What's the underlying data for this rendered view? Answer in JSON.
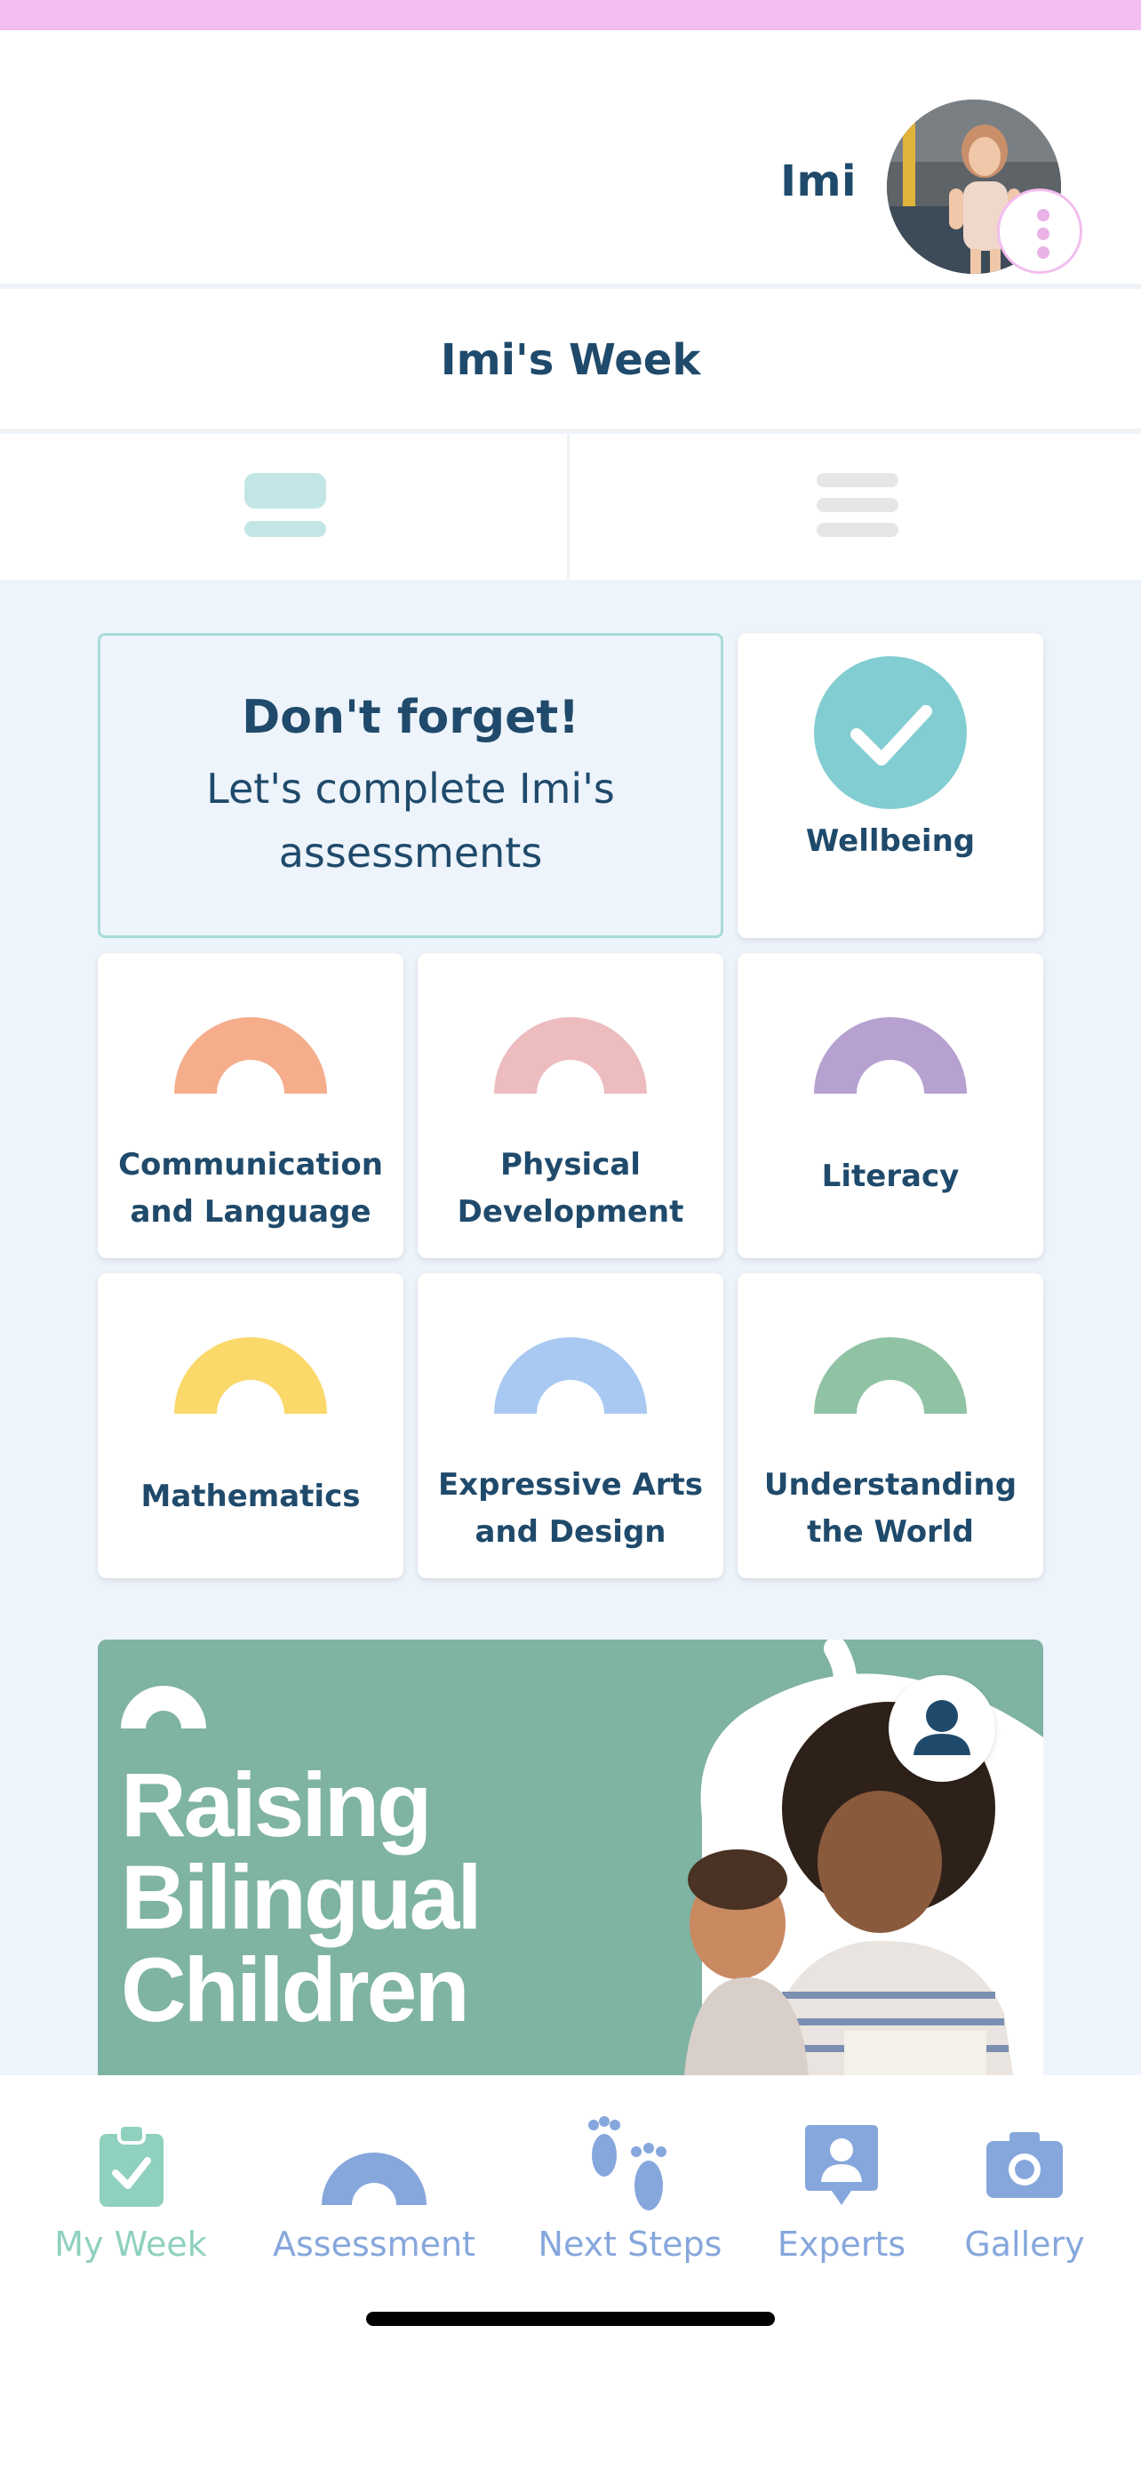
{
  "header": {
    "child_name": "Imi"
  },
  "week": {
    "title": "Imi's Week"
  },
  "reminder": {
    "title": "Don't forget!",
    "text": "Let's complete Imi's assessments"
  },
  "wellbeing": {
    "label": "Wellbeing"
  },
  "areas": [
    {
      "label": "Communication and Language",
      "color": "#f5ad8c"
    },
    {
      "label": "Physical Development",
      "color": "#ecbcbe"
    },
    {
      "label": "Literacy",
      "color": "#b7a1d0"
    },
    {
      "label": "Mathematics",
      "color": "#fad86a"
    },
    {
      "label": "Expressive Arts and Design",
      "color": "#a9c9f2"
    },
    {
      "label": "Understanding the World",
      "color": "#8fc3a4"
    }
  ],
  "banner": {
    "title": "Raising Bilingual Children"
  },
  "nav": [
    {
      "label": "My Week",
      "icon": "clipboard-check-icon",
      "color": "#8fd0be"
    },
    {
      "label": "Assessment",
      "icon": "arch-icon",
      "color": "#86a7dc"
    },
    {
      "label": "Next Steps",
      "icon": "footprints-icon",
      "color": "#86a7dc"
    },
    {
      "label": "Experts",
      "icon": "expert-person-icon",
      "color": "#86a7dc"
    },
    {
      "label": "Gallery",
      "icon": "camera-icon",
      "color": "#86a7dc"
    }
  ],
  "colors": {
    "navy": "#1f4a6b",
    "teal": "#82cdd1",
    "pink": "#f3bdf0",
    "background": "#eef4fb"
  }
}
